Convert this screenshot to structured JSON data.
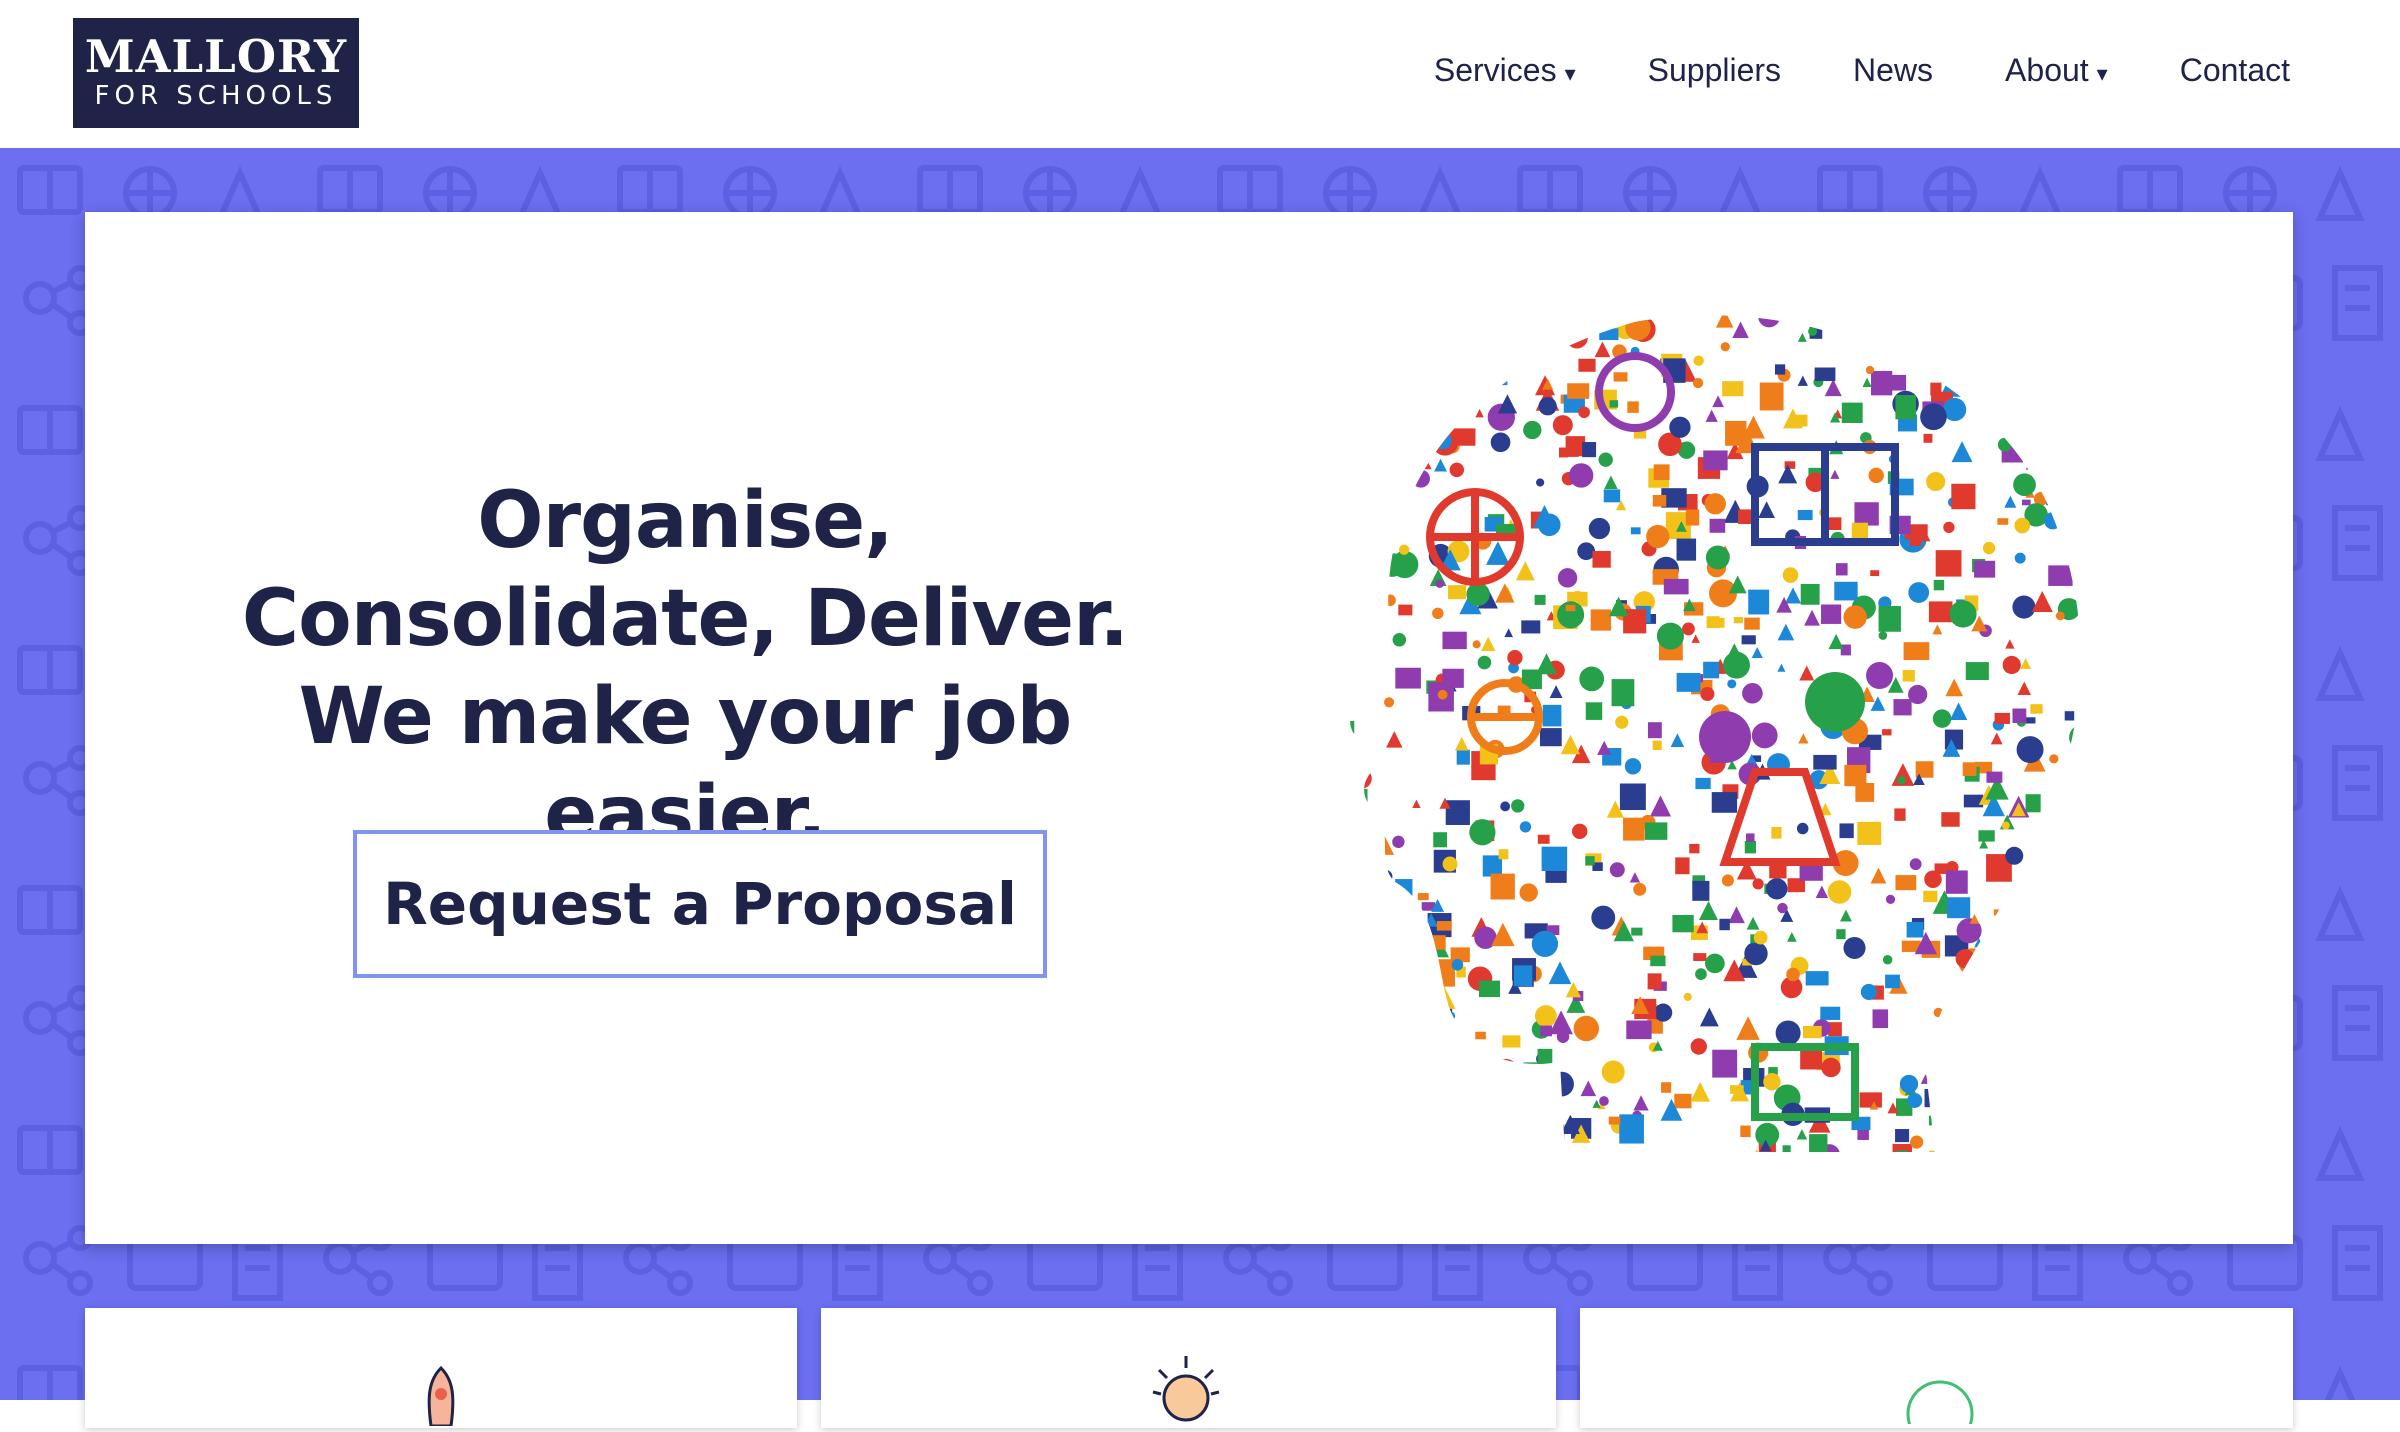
{
  "brand": {
    "name_line1": "MALLORY",
    "name_line2": "FOR SCHOOLS"
  },
  "nav": {
    "items": [
      {
        "label": "Services",
        "dropdown": true
      },
      {
        "label": "Suppliers",
        "dropdown": false
      },
      {
        "label": "News",
        "dropdown": false
      },
      {
        "label": "About",
        "dropdown": true
      },
      {
        "label": "Contact",
        "dropdown": false
      }
    ],
    "caret": "▾"
  },
  "hero": {
    "title": "Organise, Consolidate, Deliver. We make your job easier.",
    "cta_label": "Request a Proposal",
    "image_icon": "education-icons-head-illustration"
  },
  "features": {
    "icons": [
      "rocket-icon",
      "lightbulb-face-icon",
      "leaf-circle-icon"
    ]
  },
  "colors": {
    "navy": "#1e2347",
    "pattern_bg": "#6b6ff0",
    "cta_border": "#8394f0"
  }
}
